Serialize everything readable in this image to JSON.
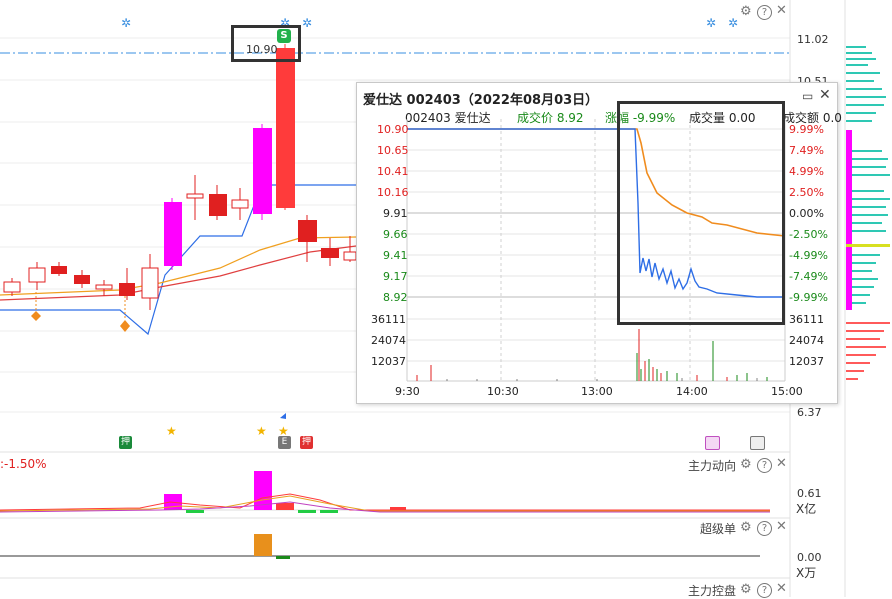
{
  "main": {
    "price_marker": "10.90",
    "price_marker_badge": "S",
    "right_axis": {
      "top": "11.02",
      "second": "10.51",
      "bottom": "6.37"
    },
    "markers": {
      "pledge1": "押",
      "pledge2": "押",
      "doc": "E"
    }
  },
  "popup": {
    "title": "爱仕达 002403（2022年08月03日）",
    "info": {
      "code_name": "002403 爱仕达",
      "price_label": "成交价 8.92",
      "change_label": "涨幅 -9.99%",
      "volume_label": "成交量 0.00",
      "amount_label": "成交额 0.0"
    },
    "left_axis": [
      "10.90",
      "10.65",
      "10.41",
      "10.16",
      "9.91",
      "9.66",
      "9.41",
      "9.17",
      "8.92"
    ],
    "right_axis": [
      "9.99%",
      "7.49%",
      "4.99%",
      "2.50%",
      "0.00%",
      "-2.50%",
      "-4.99%",
      "-7.49%",
      "-9.99%"
    ],
    "vol_axis": [
      "36111",
      "24074",
      "12037"
    ],
    "time_axis": [
      "9:30",
      "10:30",
      "13:00",
      "14:00",
      "15:00"
    ]
  },
  "panel1": {
    "label": "主力动向",
    "left_text": ":-1.50%",
    "value": "0.61",
    "unit": "X亿"
  },
  "panel2": {
    "label": "超级单",
    "value": "0.00",
    "unit": "X万"
  },
  "panel3": {
    "label": "主力控盘"
  },
  "colors": {
    "up": "#ff3b3b",
    "down": "#e02020",
    "magenta": "#ff00ff",
    "green": "#1a8a1a",
    "orange": "#f08c1e",
    "blue": "#2e6ee6",
    "teal": "#2ec8b4"
  }
}
